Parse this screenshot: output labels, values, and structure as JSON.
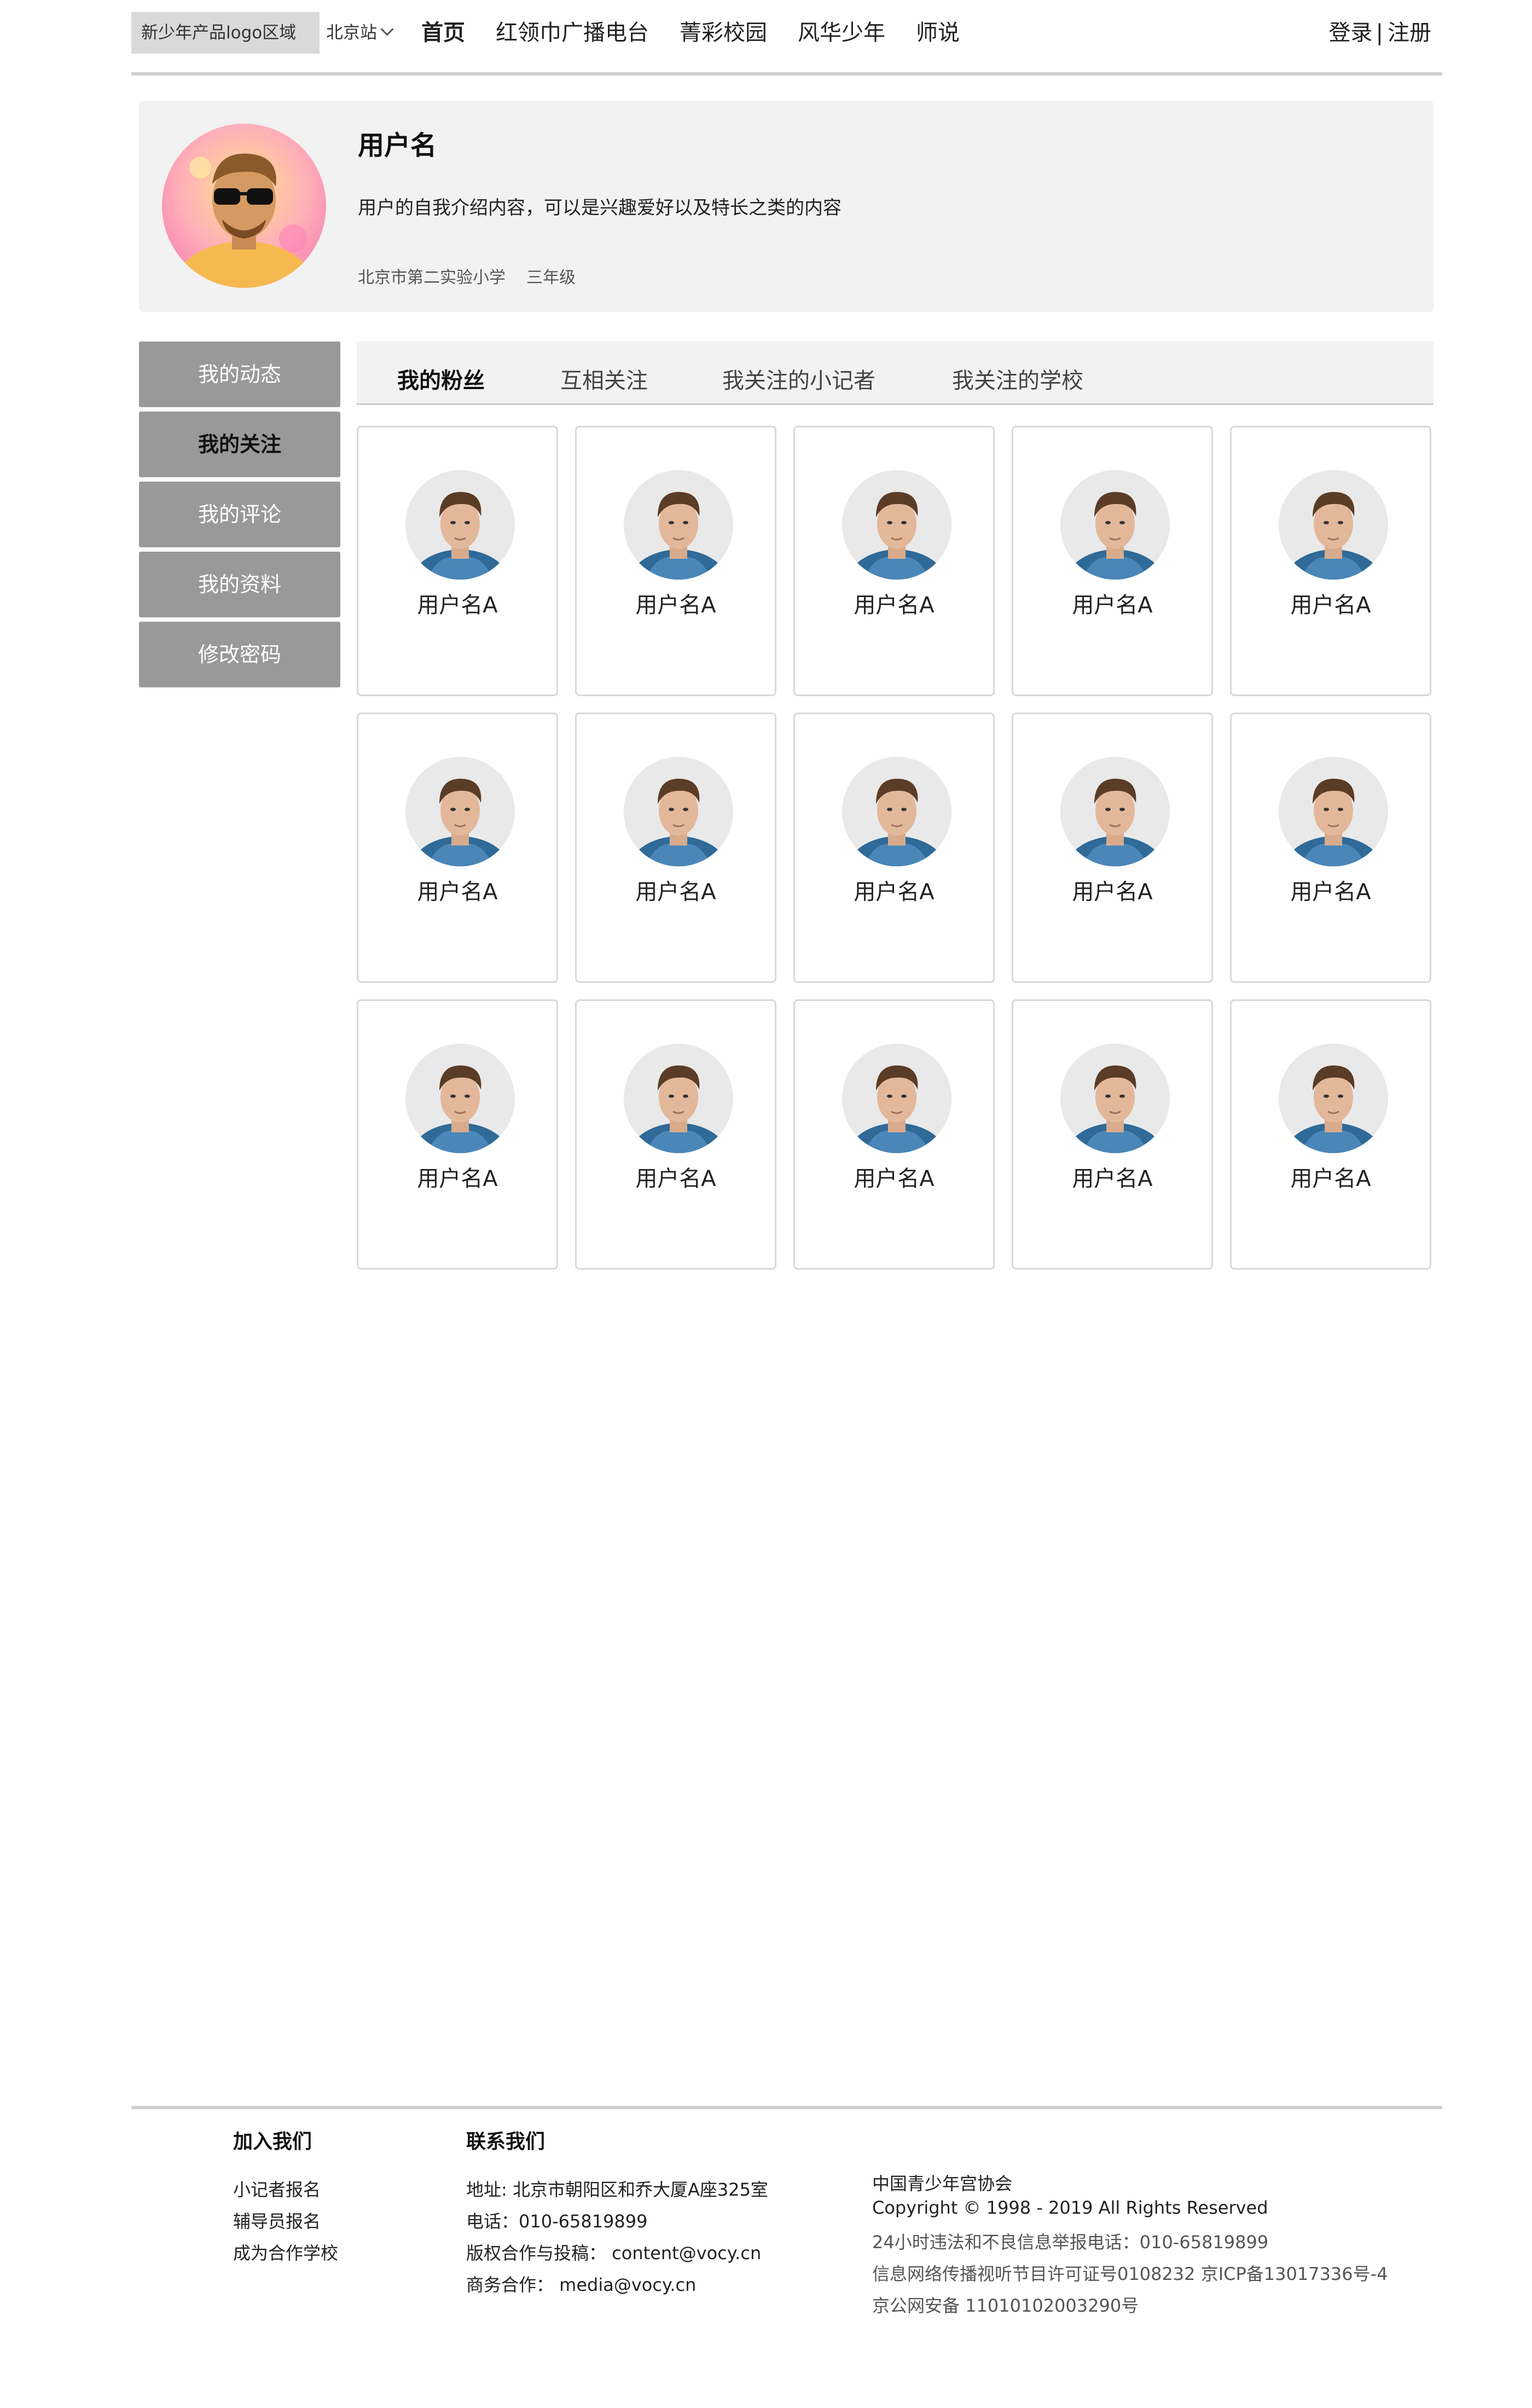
{
  "header": {
    "logo_text": "新少年产品logo区域",
    "city": "北京站",
    "nav": [
      "首页",
      "红领巾广播电台",
      "菁彩校园",
      "风华少年",
      "师说"
    ],
    "login": "登录",
    "divider": "|",
    "register": "注册"
  },
  "profile": {
    "name": "用户名",
    "bio": "用户的自我介绍内容，可以是兴趣爱好以及特长之类的内容",
    "school": "北京市第二实验小学",
    "grade": "三年级"
  },
  "side_menu": [
    "我的动态",
    "我的关注",
    "我的评论",
    "我的资料",
    "修改密码"
  ],
  "tabs": [
    "我的粉丝",
    "互相关注",
    "我关注的小记者",
    "我关注的学校"
  ],
  "users": [
    "用户名A",
    "用户名A",
    "用户名A",
    "用户名A",
    "用户名A",
    "用户名A",
    "用户名A",
    "用户名A",
    "用户名A",
    "用户名A",
    "用户名A",
    "用户名A",
    "用户名A",
    "用户名A",
    "用户名A"
  ],
  "footer": {
    "join_title": "加入我们",
    "join_links": [
      "小记者报名",
      "辅导员报名",
      "成为合作学校"
    ],
    "contact_title": "联系我们",
    "contact_lines": [
      "地址: 北京市朝阳区和乔大厦A座325室",
      "电话：010-65819899",
      "版权合作与投稿： content@vocy.cn",
      "商务合作： media@vocy.cn"
    ],
    "org": "中国青少年宫协会",
    "copyright": "Copyright © 1998 - 2019 All Rights Reserved",
    "report": "24小时违法和不良信息举报电话：010-65819899",
    "license": "信息网络传播视听节目许可证号0108232 京ICP备13017336号-4",
    "police": "京公网安备 11010102003290号"
  },
  "icons": {
    "city_dropdown": "chevron-down-icon",
    "profile_avatar": "avatar",
    "user_avatar": "avatar"
  }
}
